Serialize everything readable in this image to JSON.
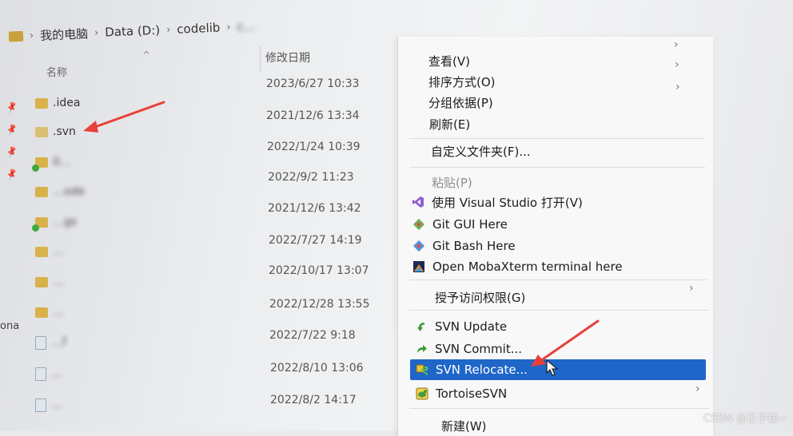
{
  "breadcrumb": {
    "items": [
      "我的电脑",
      "Data (D:)",
      "codelib",
      "c…"
    ]
  },
  "columns": {
    "name": "名称",
    "date": "修改日期"
  },
  "files": [
    {
      "name": ".idea",
      "date": "2023/6/27 10:33",
      "icon": "folder-icon"
    },
    {
      "name": ".svn",
      "date": "2021/12/6 13:34",
      "icon": "folder-icon"
    },
    {
      "name": "0…",
      "date": "2022/1/24 10:39",
      "icon": "folder-svn-icon"
    },
    {
      "name": "…ode",
      "date": "2022/9/2 11:23",
      "icon": "folder-icon"
    },
    {
      "name": "…gs",
      "date": "2021/12/6 13:42",
      "icon": "folder-svn-icon"
    },
    {
      "name": "…",
      "date": "2022/7/27 14:19",
      "icon": "folder-icon"
    },
    {
      "name": "…",
      "date": "2022/10/17 13:07",
      "icon": "folder-icon"
    },
    {
      "name": "…",
      "date": "2022/12/28 13:55",
      "icon": "folder-icon"
    },
    {
      "name": "…f",
      "date": "2022/7/22 9:18",
      "icon": "document-icon"
    },
    {
      "name": "…",
      "date": "2022/8/10 13:06",
      "icon": "document-icon"
    },
    {
      "name": "…",
      "date": "2022/8/2 14:17",
      "icon": "document-icon"
    }
  ],
  "edge_label": "ona",
  "context_menu": {
    "items": [
      {
        "label": "查看(V)",
        "submenu": true
      },
      {
        "label": "排序方式(O)",
        "submenu": true
      },
      {
        "label": "分组依据(P)",
        "submenu": true
      },
      {
        "label": "刷新(E)"
      },
      {
        "label": "自定义文件夹(F)..."
      },
      {
        "label": "粘贴(P)",
        "disabled": true
      },
      {
        "label": "使用 Visual Studio 打开(V)",
        "icon": "visual-studio-icon"
      },
      {
        "label": "Git GUI Here",
        "icon": "git-gui-icon"
      },
      {
        "label": "Git Bash Here",
        "icon": "git-bash-icon"
      },
      {
        "label": "Open MobaXterm terminal here",
        "icon": "mobaxterm-icon"
      },
      {
        "label": "授予访问权限(G)",
        "submenu": true
      },
      {
        "label": "SVN Update",
        "icon": "svn-update-icon"
      },
      {
        "label": "SVN Commit...",
        "icon": "svn-commit-icon"
      },
      {
        "label": "SVN Relocate...",
        "icon": "svn-relocate-icon",
        "highlighted": true
      },
      {
        "label": "TortoiseSVN",
        "icon": "tortoisesvn-icon",
        "submenu": true
      },
      {
        "label": "新建(W)"
      }
    ]
  },
  "watermark": "CSDN @王子様~",
  "colors": {
    "highlight": "#1f66c9",
    "annotation_arrow": "#e8403a",
    "folder": "#d8b24a"
  }
}
